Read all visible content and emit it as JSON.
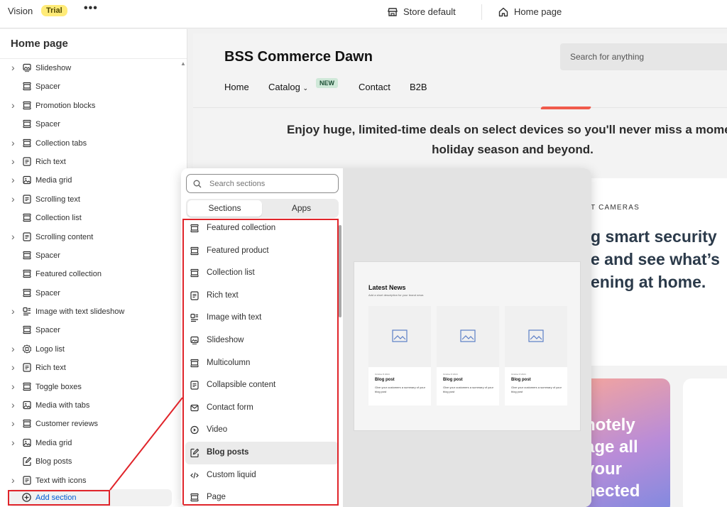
{
  "topbar": {
    "app_name": "Vision",
    "trial_badge": "Trial",
    "more_label": "•••",
    "store_label": "Store default",
    "page_label": "Home page"
  },
  "sidebar": {
    "title": "Home page",
    "items": [
      {
        "label": "Slideshow",
        "icon": "slideshow-icon",
        "expandable": true
      },
      {
        "label": "Spacer",
        "icon": "section-icon",
        "expandable": false
      },
      {
        "label": "Promotion blocks",
        "icon": "section-icon",
        "expandable": true
      },
      {
        "label": "Spacer",
        "icon": "section-icon",
        "expandable": false
      },
      {
        "label": "Collection tabs",
        "icon": "section-icon",
        "expandable": true
      },
      {
        "label": "Rich text",
        "icon": "text-icon",
        "expandable": true
      },
      {
        "label": "Media grid",
        "icon": "image-icon",
        "expandable": true
      },
      {
        "label": "Scrolling text",
        "icon": "text-icon",
        "expandable": true
      },
      {
        "label": "Collection list",
        "icon": "section-icon",
        "expandable": false
      },
      {
        "label": "Scrolling content",
        "icon": "text-icon",
        "expandable": true
      },
      {
        "label": "Spacer",
        "icon": "section-icon",
        "expandable": false
      },
      {
        "label": "Featured collection",
        "icon": "section-icon",
        "expandable": false
      },
      {
        "label": "Spacer",
        "icon": "section-icon",
        "expandable": false
      },
      {
        "label": "Image with text slideshow",
        "icon": "image-text-icon",
        "expandable": true
      },
      {
        "label": "Spacer",
        "icon": "section-icon",
        "expandable": false
      },
      {
        "label": "Logo list",
        "icon": "logo-icon",
        "expandable": true
      },
      {
        "label": "Rich text",
        "icon": "text-icon",
        "expandable": true
      },
      {
        "label": "Toggle boxes",
        "icon": "section-icon",
        "expandable": true
      },
      {
        "label": "Media with tabs",
        "icon": "image-icon",
        "expandable": true
      },
      {
        "label": "Customer reviews",
        "icon": "section-icon",
        "expandable": true
      },
      {
        "label": "Media grid",
        "icon": "image-icon",
        "expandable": true
      },
      {
        "label": "Blog posts",
        "icon": "edit-icon",
        "expandable": false
      },
      {
        "label": "Text with icons",
        "icon": "text-icon",
        "expandable": true
      }
    ],
    "add_section_label": "Add section"
  },
  "preview": {
    "store_title": "BSS Commerce Dawn",
    "search_placeholder": "Search for anything",
    "nav": [
      "Home",
      "Catalog",
      "Contact",
      "B2B"
    ],
    "new_badge": "NEW",
    "promo_line1": "Enjoy huge, limited-time deals on select devices so you'll never miss a momen",
    "promo_line2": "holiday season and beyond.",
    "cam_label": "T CAMERAS",
    "hero_line1": "g smart security",
    "hero_line2": "e and see what’s",
    "hero_line3": "ening at home.",
    "grad_line1": "notely",
    "grad_line2": "age all",
    "grad_line3": "your",
    "grad_line4": "nected"
  },
  "picker": {
    "search_placeholder": "Search sections",
    "tabs": [
      "Sections",
      "Apps"
    ],
    "items": [
      {
        "label": "Featured collection",
        "icon": "section-icon"
      },
      {
        "label": "Featured product",
        "icon": "section-icon"
      },
      {
        "label": "Collection list",
        "icon": "section-icon"
      },
      {
        "label": "Rich text",
        "icon": "text-icon"
      },
      {
        "label": "Image with text",
        "icon": "image-text-icon"
      },
      {
        "label": "Slideshow",
        "icon": "slideshow-icon"
      },
      {
        "label": "Multicolumn",
        "icon": "section-icon"
      },
      {
        "label": "Collapsible content",
        "icon": "text-icon"
      },
      {
        "label": "Contact form",
        "icon": "mail-icon"
      },
      {
        "label": "Video",
        "icon": "play-icon"
      },
      {
        "label": "Blog posts",
        "icon": "edit-icon"
      },
      {
        "label": "Custom liquid",
        "icon": "code-icon"
      },
      {
        "label": "Page",
        "icon": "section-icon"
      }
    ],
    "selected_index": 10,
    "preview_card": {
      "title": "Latest News",
      "subtitle": "Add a short description for your brand news",
      "post_meta": "October 8 2024",
      "post_title": "Blog post",
      "post_desc": "Give your customers a summary of your blog post"
    }
  },
  "colors": {
    "highlight_red": "#e0242a",
    "link_blue": "#005bd3",
    "trial_yellow": "#ffeb78"
  }
}
